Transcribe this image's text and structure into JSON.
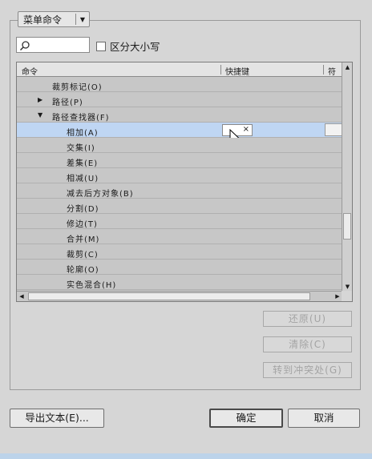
{
  "category_dropdown": {
    "value": "菜单命令"
  },
  "search": {
    "value": "",
    "placeholder": ""
  },
  "case_sensitive": {
    "label": "区分大小写",
    "checked": false
  },
  "table": {
    "columns": {
      "command": "命令",
      "shortcut": "快捷键",
      "symbol": "符号"
    },
    "rows": [
      {
        "label": "裁剪标记(O)"
      },
      {
        "label": "路径(P)",
        "expander": "▶"
      },
      {
        "label": "路径查找器(F)",
        "expander": "▼"
      },
      {
        "label": "相加(A)",
        "selected": true
      },
      {
        "label": "交集(I)"
      },
      {
        "label": "差集(E)"
      },
      {
        "label": "相减(U)"
      },
      {
        "label": "减去后方对象(B)"
      },
      {
        "label": "分割(D)"
      },
      {
        "label": "修边(T)"
      },
      {
        "label": "合并(M)"
      },
      {
        "label": "裁剪(C)"
      },
      {
        "label": "轮廓(O)"
      },
      {
        "label": "实色混合(H)"
      }
    ],
    "shortcut_clear": "×"
  },
  "side_buttons": {
    "restore": "还原(U)",
    "clear": "清除(C)",
    "goto_conflict": "转到冲突处(G)"
  },
  "bottom_buttons": {
    "export": "导出文本(E)...",
    "ok": "确定",
    "cancel": "取消"
  },
  "colors": {
    "selection": "#bfd6f3",
    "background": "#d6d6d6"
  }
}
